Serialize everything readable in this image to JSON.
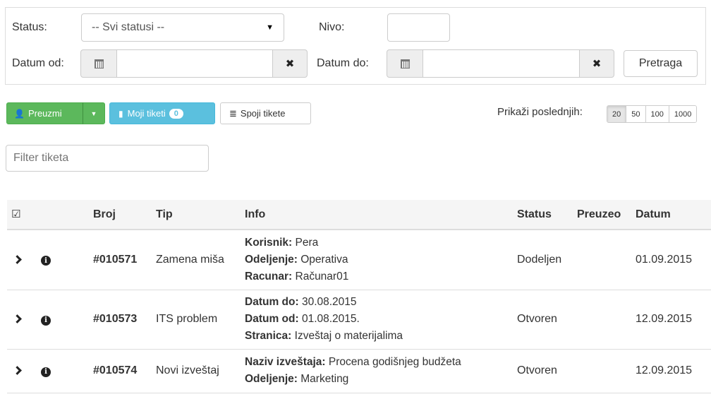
{
  "filters": {
    "status_label": "Status:",
    "status_value": "-- Svi statusi --",
    "nivo_label": "Nivo:",
    "nivo_value": "",
    "datum_od_label": "Datum od:",
    "datum_od_value": "",
    "datum_do_label": "Datum do:",
    "datum_do_value": "",
    "clear_glyph": "✖",
    "search_button": "Pretraga"
  },
  "toolbar": {
    "preuzmi_label": "Preuzmi",
    "moji_tiketi_label": "Moji tiketi",
    "moji_tiketi_count": "0",
    "spoji_label": "Spoji tikete",
    "prikazi_label": "Prikaži poslednjih:",
    "page_sizes": [
      "20",
      "50",
      "100",
      "1000"
    ],
    "active_page_size": "20"
  },
  "filter_input": {
    "placeholder": "Filter tiketa"
  },
  "table": {
    "headers": {
      "broj": "Broj",
      "tip": "Tip",
      "info": "Info",
      "status": "Status",
      "preuzeo": "Preuzeo",
      "datum": "Datum"
    },
    "rows": [
      {
        "broj": "#010571",
        "tip": "Zamena miša",
        "info": [
          {
            "key": "Korisnik:",
            "value": "Pera"
          },
          {
            "key": "Odeljenje:",
            "value": "Operativa"
          },
          {
            "key": "Racunar:",
            "value": "Računar01"
          }
        ],
        "status": "Dodeljen",
        "preuzeo": "",
        "datum": "01.09.2015"
      },
      {
        "broj": "#010573",
        "tip": "ITS problem",
        "info": [
          {
            "key": "Datum do:",
            "value": "30.08.2015"
          },
          {
            "key": "Datum od:",
            "value": "01.08.2015."
          },
          {
            "key": "Stranica:",
            "value": "Izveštaj o materijalima"
          }
        ],
        "status": "Otvoren",
        "preuzeo": "",
        "datum": "12.09.2015"
      },
      {
        "broj": "#010574",
        "tip": "Novi izveštaj",
        "info": [
          {
            "key": "Naziv izveštaja:",
            "value": "Procena godišnjeg budžeta"
          },
          {
            "key": "Odeljenje:",
            "value": "Marketing"
          }
        ],
        "status": "Otvoren",
        "preuzeo": "",
        "datum": "12.09.2015"
      }
    ]
  },
  "colors": {
    "green": "#5cb85c",
    "blue": "#5bc0de"
  }
}
